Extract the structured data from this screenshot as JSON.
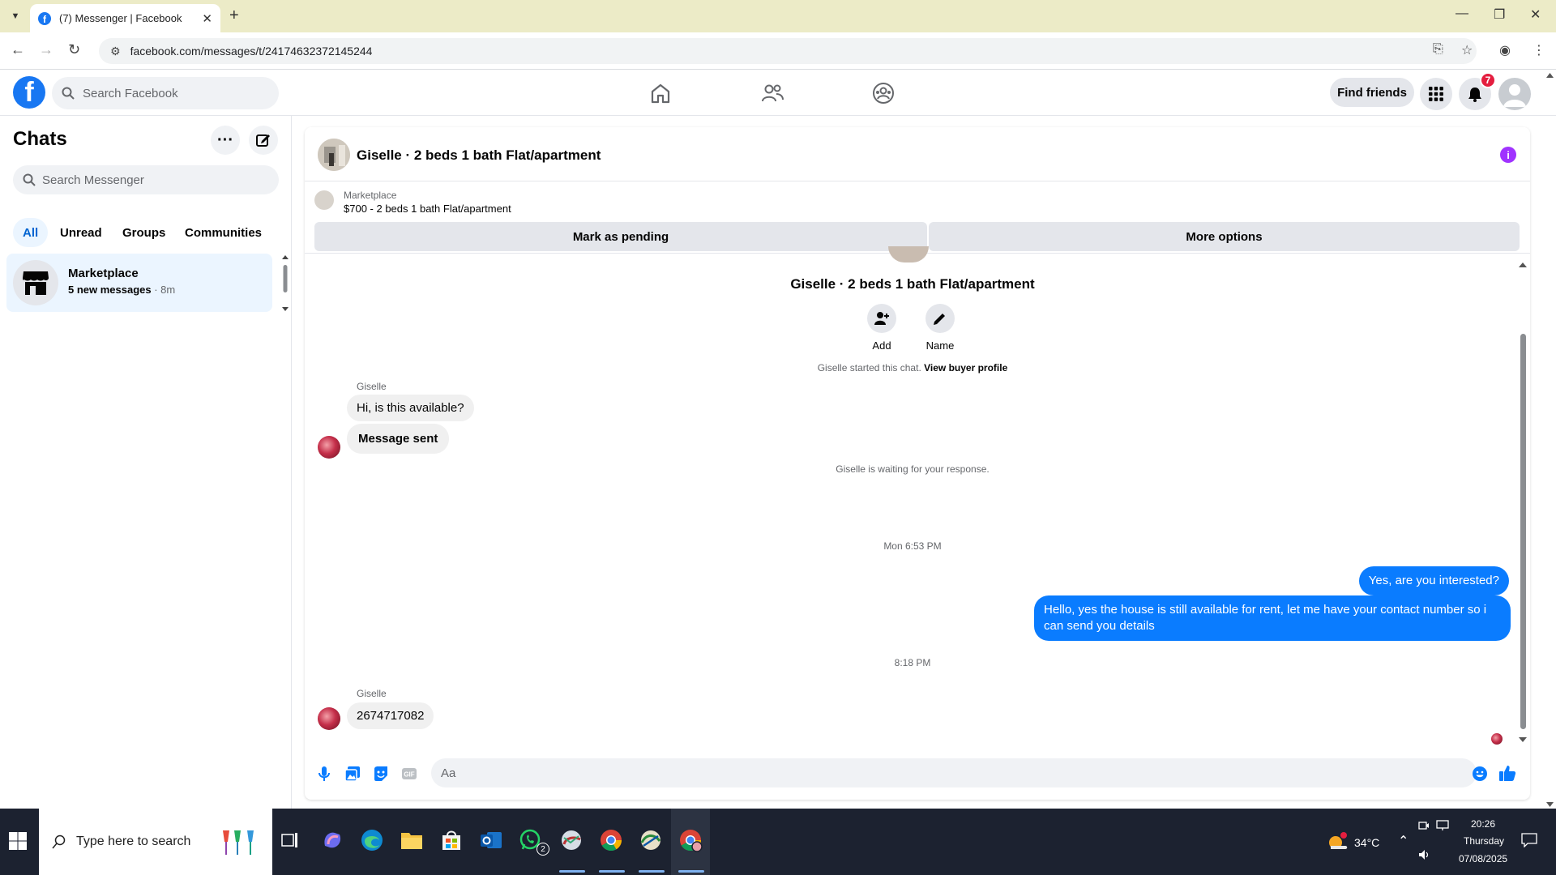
{
  "browser": {
    "tab_title": "(7) Messenger | Facebook",
    "url": "facebook.com/messages/t/24174632372145244"
  },
  "fb": {
    "search_placeholder": "Search Facebook",
    "find_friends": "Find friends",
    "notification_count": "7"
  },
  "left": {
    "title": "Chats",
    "search_placeholder": "Search Messenger",
    "filters": [
      "All",
      "Unread",
      "Groups",
      "Communities"
    ],
    "chat": {
      "name": "Marketplace",
      "preview": "5 new messages",
      "time": " · 8m"
    }
  },
  "conversation": {
    "title": "Giselle · 2 beds 1 bath Flat/apartment",
    "marketplace_label": "Marketplace",
    "listing": "$700 - 2 beds 1 bath Flat/apartment",
    "mark_pending": "Mark as pending",
    "more_options": "More options",
    "chat_name": "Giselle · 2 beds 1 bath Flat/apartment",
    "add_label": "Add",
    "name_label": "Name",
    "started_text": "Giselle started this chat.",
    "view_buyer_profile": "View buyer profile",
    "sender_1": "Giselle",
    "msg_1": "Hi, is this available?",
    "msg_2": "Message sent",
    "waiting": "Giselle is waiting for your response.",
    "timestamp_1": "Mon 6:53 PM",
    "out_1": "Yes, are you interested?",
    "out_2": "Hello, yes the house is still available for rent, let me have your contact number so i can send you details",
    "timestamp_2": "8:18 PM",
    "sender_2": "Giselle",
    "msg_3": "2674717082",
    "composer_placeholder": "Aa"
  },
  "taskbar": {
    "search_placeholder": "Type here to search",
    "weather": "34°C",
    "time": "20:26",
    "day": "Thursday",
    "date": "07/08/2025",
    "whatsapp_badge": "2"
  },
  "colors": {
    "fb_blue": "#1877f2",
    "bubble_out": "#0a7cff",
    "info_purple": "#a033ff"
  }
}
